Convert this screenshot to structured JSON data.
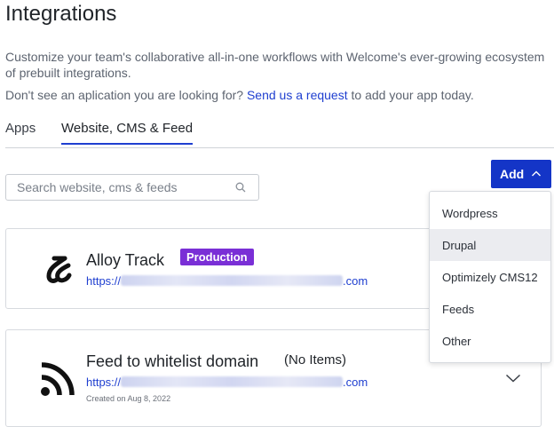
{
  "page": {
    "title": "Integrations",
    "description": "Customize your team's collaborative all-in-one workflows with Welcome's ever-growing ecosystem of prebuilt integrations.",
    "request_prefix": "Don't see an aplication you are looking for?",
    "request_link": "Send us a request",
    "request_suffix": " to add your app today."
  },
  "tabs": [
    {
      "label": "Apps",
      "active": false
    },
    {
      "label": "Website, CMS & Feed",
      "active": true
    }
  ],
  "search": {
    "placeholder": "Search website, cms & feeds",
    "value": "",
    "icon": "search-icon"
  },
  "add_button": {
    "label": "Add",
    "icon": "chevron-up-icon",
    "color": "#1435c7"
  },
  "add_menu": {
    "options": [
      "Wordpress",
      "Drupal",
      "Optimizely CMS12",
      "Feeds",
      "Other"
    ],
    "highlighted": "Drupal"
  },
  "integrations": [
    {
      "name": "Alloy Track",
      "badge": "Production",
      "badge_color": "#7a2fd6",
      "url_prefix": "https://",
      "url_suffix": ".com",
      "icon": "alloy-track-logo"
    },
    {
      "name": "Feed to whitelist domain",
      "status": "(No Items)",
      "url_prefix": "https://",
      "url_suffix": ".com",
      "created": "Created on Aug 8, 2022",
      "icon": "rss-icon",
      "expand_icon": "chevron-down-icon"
    }
  ]
}
